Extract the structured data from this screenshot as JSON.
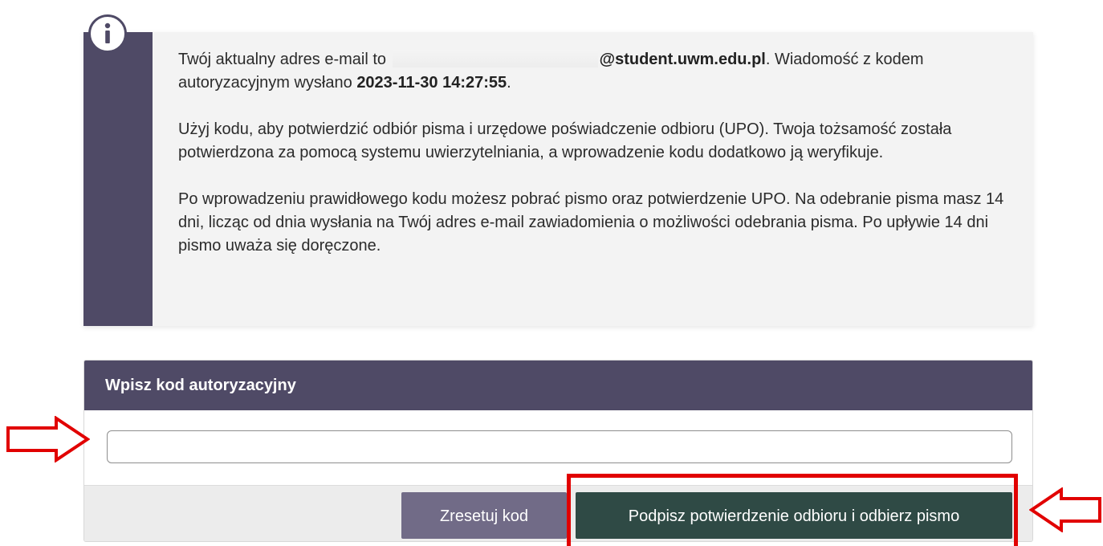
{
  "info": {
    "line1_prefix": "Twój aktualny adres e-mail to",
    "email_domain": "@student.uwm.edu.pl",
    "line1_suffix": ". Wiadomość z kodem autoryzacyjnym wysłano",
    "sent_datetime": "2023-11-30 14:27:55",
    "line1_end": ".",
    "paragraph2": "Użyj kodu, aby potwierdzić odbiór pisma i urzędowe poświadczenie odbioru (UPO). Twoja tożsamość została potwierdzona za pomocą systemu uwierzytelniania, a wprowadzenie kodu dodatkowo ją weryfikuje.",
    "paragraph3": "Po wprowadzeniu prawidłowego kodu możesz pobrać pismo oraz potwierdzenie UPO. Na odebranie pisma masz 14 dni, licząc od dnia wysłania na Twój adres e-mail zawiadomienia o możliwości odebrania pisma. Po upływie 14 dni pismo uważa się doręczone."
  },
  "code_form": {
    "title": "Wpisz kod autoryzacyjny",
    "input_value": "",
    "input_placeholder": "",
    "reset_label": "Zresetuj kod",
    "submit_label": "Podpisz potwierdzenie odbioru i odbierz pismo"
  },
  "colors": {
    "header_purple": "#4f4a66",
    "reset_button": "#716b87",
    "submit_button": "#2f4a45",
    "annotation_red": "#e10000"
  },
  "icons": {
    "info": "info-circle-icon",
    "annotation_arrow": "outline-arrow-icon"
  }
}
